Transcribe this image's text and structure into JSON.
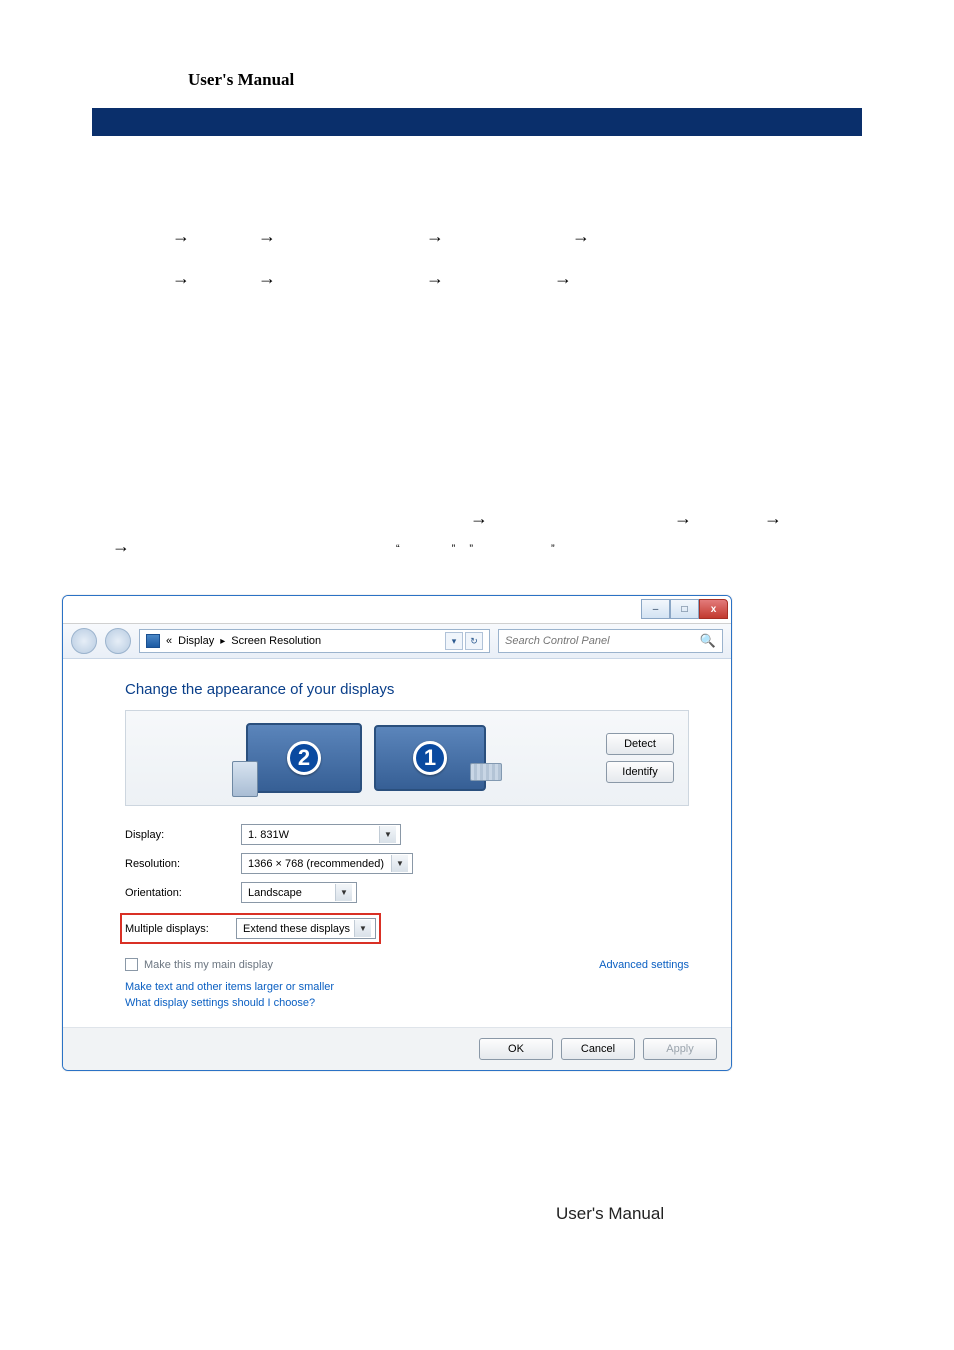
{
  "header": {
    "title": "User's Manual"
  },
  "marks": {
    "oq": "“",
    "cq": "”"
  },
  "win": {
    "crumb": {
      "prefix": "«",
      "seg1": "Display",
      "seg2": "Screen Resolution"
    },
    "search_placeholder": "Search Control Panel",
    "heading": "Change the appearance of your displays",
    "monitors": [
      {
        "id": "1"
      },
      {
        "id": "2"
      }
    ],
    "btn_detect": "Detect",
    "btn_identify": "Identify",
    "labels": {
      "display": "Display:",
      "resolution": "Resolution:",
      "orientation": "Orientation:",
      "multiple": "Multiple displays:"
    },
    "values": {
      "display": "1. 831W",
      "resolution": "1366 × 768 (recommended)",
      "orientation": "Landscape",
      "multiple": "Extend these displays"
    },
    "make_main": "Make this my main display",
    "advanced": "Advanced settings",
    "link_textsize": "Make text and other items larger or smaller",
    "link_help": "What display settings should I choose?",
    "btn_ok": "OK",
    "btn_cancel": "Cancel",
    "btn_apply": "Apply"
  },
  "footer": {
    "text": "User's Manual"
  }
}
